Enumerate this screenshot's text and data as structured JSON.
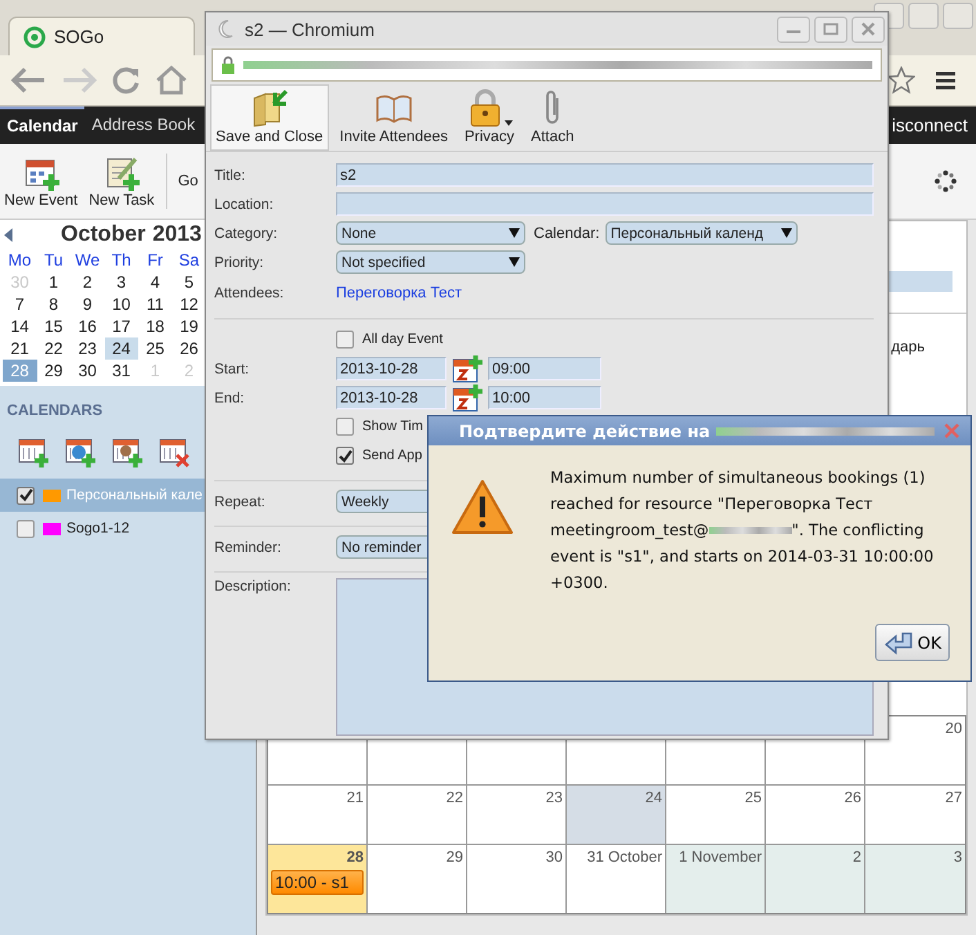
{
  "browser": {
    "tab_title": "SOGo"
  },
  "app_tabs": [
    {
      "label": "Calendar",
      "selected": true
    },
    {
      "label": "Address Book",
      "selected": false
    }
  ],
  "disconnect": "isconnect",
  "toolbar": [
    {
      "label": "New Event",
      "kind": "event"
    },
    {
      "label": "New Task",
      "kind": "task"
    },
    {
      "label": "Go",
      "kind": "go"
    }
  ],
  "mini_calendar": {
    "month": "October",
    "year": "2013",
    "weekdays": [
      "Mo",
      "Tu",
      "We",
      "Th",
      "Fr",
      "Sa"
    ],
    "weeks": [
      [
        {
          "day": "30",
          "other_month": true,
          "today": false,
          "selected": false
        },
        {
          "day": "1",
          "other_month": false,
          "today": false,
          "selected": false
        },
        {
          "day": "2",
          "other_month": false,
          "today": false,
          "selected": false
        },
        {
          "day": "3",
          "other_month": false,
          "today": false,
          "selected": false
        },
        {
          "day": "4",
          "other_month": false,
          "today": false,
          "selected": false
        },
        {
          "day": "5",
          "other_month": false,
          "today": false,
          "selected": false
        }
      ],
      [
        {
          "day": "7",
          "other_month": false,
          "today": false,
          "selected": false
        },
        {
          "day": "8",
          "other_month": false,
          "today": false,
          "selected": false
        },
        {
          "day": "9",
          "other_month": false,
          "today": false,
          "selected": false
        },
        {
          "day": "10",
          "other_month": false,
          "today": false,
          "selected": false
        },
        {
          "day": "11",
          "other_month": false,
          "today": false,
          "selected": false
        },
        {
          "day": "12",
          "other_month": false,
          "today": false,
          "selected": false
        }
      ],
      [
        {
          "day": "14",
          "other_month": false,
          "today": false,
          "selected": false
        },
        {
          "day": "15",
          "other_month": false,
          "today": false,
          "selected": false
        },
        {
          "day": "16",
          "other_month": false,
          "today": false,
          "selected": false
        },
        {
          "day": "17",
          "other_month": false,
          "today": false,
          "selected": false
        },
        {
          "day": "18",
          "other_month": false,
          "today": false,
          "selected": false
        },
        {
          "day": "19",
          "other_month": false,
          "today": false,
          "selected": false
        }
      ],
      [
        {
          "day": "21",
          "other_month": false,
          "today": false,
          "selected": false
        },
        {
          "day": "22",
          "other_month": false,
          "today": false,
          "selected": false
        },
        {
          "day": "23",
          "other_month": false,
          "today": false,
          "selected": false
        },
        {
          "day": "24",
          "other_month": false,
          "today": true,
          "selected": false
        },
        {
          "day": "25",
          "other_month": false,
          "today": false,
          "selected": false
        },
        {
          "day": "26",
          "other_month": false,
          "today": false,
          "selected": false
        }
      ],
      [
        {
          "day": "28",
          "other_month": false,
          "today": false,
          "selected": true
        },
        {
          "day": "29",
          "other_month": false,
          "today": false,
          "selected": false
        },
        {
          "day": "30",
          "other_month": false,
          "today": false,
          "selected": false
        },
        {
          "day": "31",
          "other_month": false,
          "today": false,
          "selected": false
        },
        {
          "day": "1",
          "other_month": true,
          "today": false,
          "selected": false
        },
        {
          "day": "2",
          "other_month": true,
          "today": false,
          "selected": false
        }
      ]
    ]
  },
  "calendars_header": "CALENDARS",
  "calendar_actions": [
    {
      "kind": "add"
    },
    {
      "kind": "web"
    },
    {
      "kind": "subscribe"
    },
    {
      "kind": "delete"
    }
  ],
  "calendars": [
    {
      "name": "Персональный кале",
      "color": "#ff9900",
      "checked": true,
      "selected": true
    },
    {
      "name": "Sogo1-12",
      "color": "#ff00ff",
      "checked": false,
      "selected": false
    }
  ],
  "main": {
    "view_label": "дарь",
    "month_rows": [
      {
        "cells": [
          {
            "day": "20",
            "today": false,
            "selected": false,
            "other_month": false
          }
        ]
      },
      {
        "cells": [
          {
            "day": "21",
            "today": false,
            "selected": false,
            "other_month": false
          },
          {
            "day": "22",
            "today": false,
            "selected": false,
            "other_month": false
          },
          {
            "day": "23",
            "today": false,
            "selected": false,
            "other_month": false
          },
          {
            "day": "24",
            "today": true,
            "selected": false,
            "other_month": false
          },
          {
            "day": "25",
            "today": false,
            "selected": false,
            "other_month": false
          },
          {
            "day": "26",
            "today": false,
            "selected": false,
            "other_month": false
          },
          {
            "day": "27",
            "today": false,
            "selected": false,
            "other_month": false
          }
        ]
      },
      {
        "cells": [
          {
            "day": "28",
            "today": false,
            "selected": true,
            "other_month": false,
            "events": [
              "10:00 - s1"
            ]
          },
          {
            "day": "29",
            "today": false,
            "selected": false,
            "other_month": false
          },
          {
            "day": "30",
            "today": false,
            "selected": false,
            "other_month": false
          },
          {
            "day": "31 October",
            "today": false,
            "selected": false,
            "other_month": false
          },
          {
            "day": "1 November",
            "today": false,
            "selected": false,
            "other_month": true
          },
          {
            "day": "2",
            "today": false,
            "selected": false,
            "other_month": true
          },
          {
            "day": "3",
            "today": false,
            "selected": false,
            "other_month": true
          }
        ]
      }
    ]
  },
  "popup": {
    "title": "s2 — Chromium",
    "toolbar": [
      {
        "label": "Save and Close",
        "kind": "save",
        "highlighted": true
      },
      {
        "label": "Invite Attendees",
        "kind": "invite",
        "highlighted": false
      },
      {
        "label": "Privacy",
        "kind": "privacy",
        "highlighted": false
      },
      {
        "label": "Attach",
        "kind": "attach",
        "highlighted": false
      }
    ],
    "fields": [
      {
        "kind": "text",
        "label": "Title:",
        "value": "s2"
      },
      {
        "kind": "text",
        "label": "Location:"
      },
      {
        "kind": "select",
        "label": "Category:",
        "value": "None",
        "caret": true,
        "extra_label": "Calendar:",
        "extra_value": "Персональный календ"
      },
      {
        "kind": "select",
        "label": "Priority:",
        "value": "Not specified",
        "caret": true
      },
      {
        "kind": "link",
        "label": "Attendees:",
        "value": "Переговорка Тест"
      },
      {
        "kind": "divider"
      },
      {
        "kind": "checkbox",
        "text": "All day Event",
        "checked": false
      },
      {
        "kind": "datetime",
        "label": "Start:",
        "date": "2013-10-28",
        "time": "09:00"
      },
      {
        "kind": "datetime",
        "label": "End:",
        "date": "2013-10-28",
        "time": "10:00"
      },
      {
        "kind": "checkbox",
        "text": "Show Tim",
        "checked": false
      },
      {
        "kind": "checkbox",
        "text": "Send App",
        "checked": true
      },
      {
        "kind": "divider"
      },
      {
        "kind": "select",
        "label": "Repeat:",
        "value": "Weekly"
      },
      {
        "kind": "divider"
      },
      {
        "kind": "select",
        "label": "Reminder:",
        "value": "No reminder"
      },
      {
        "kind": "divider"
      },
      {
        "kind": "textarea",
        "label": "Description:"
      }
    ]
  },
  "dialog": {
    "title": "Подтвердите действие на",
    "message_before": "Maximum number of simultaneous bookings (1) reached for resource \"Переговорка Тест meetingroom_test@",
    "message_after": "\". The conflicting event is \"s1\", and starts on 2014-03-31 10:00:00 +0300.",
    "button": "OK"
  }
}
